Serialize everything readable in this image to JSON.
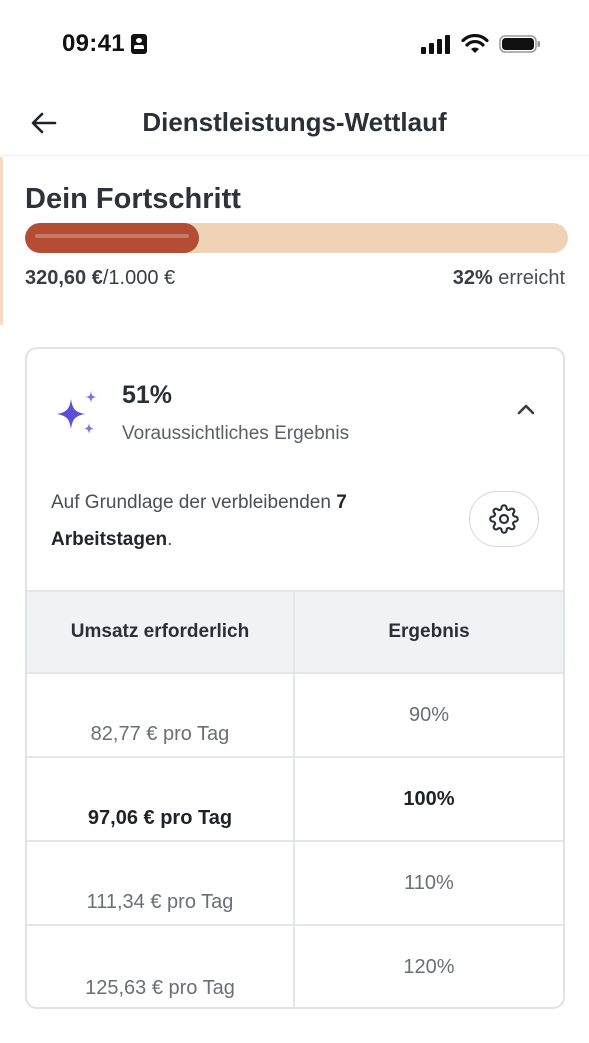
{
  "status_bar": {
    "time": "09:41",
    "icons": [
      "id-icon",
      "signal-icon",
      "wifi-icon",
      "battery-icon"
    ]
  },
  "nav": {
    "title": "Dienstleistungs-Wettlauf",
    "back_icon": "arrow-left-icon"
  },
  "progress": {
    "title": "Dein Fortschritt",
    "current_amount": "320,60 €",
    "target_amount": "/1.000 €",
    "percent_value": "32%",
    "percent_suffix": " erreicht",
    "fill_fraction": 0.32,
    "colors": {
      "fill": "#b54d34",
      "track": "#f0d3b5"
    }
  },
  "forecast": {
    "value": "51%",
    "label": "Voraussichtliches Ergebnis",
    "icon": "sparkles-icon",
    "expanded": true,
    "basis_prefix": "Auf Grundlage der verbleibenden ",
    "basis_bold": "7 Arbeitstagen",
    "basis_suffix": ".",
    "settings_icon": "gear-icon",
    "accent_color": "#5a4fd8"
  },
  "table": {
    "headers": [
      "Umsatz erforderlich",
      "Ergebnis"
    ],
    "rows": [
      {
        "required": "82,77 € pro Tag",
        "result": "90%",
        "highlight": false
      },
      {
        "required": "97,06 € pro Tag",
        "result": "100%",
        "highlight": true
      },
      {
        "required": "111,34 € pro Tag",
        "result": "110%",
        "highlight": false
      },
      {
        "required": "125,63 € pro Tag",
        "result": "120%",
        "highlight": false
      }
    ]
  }
}
